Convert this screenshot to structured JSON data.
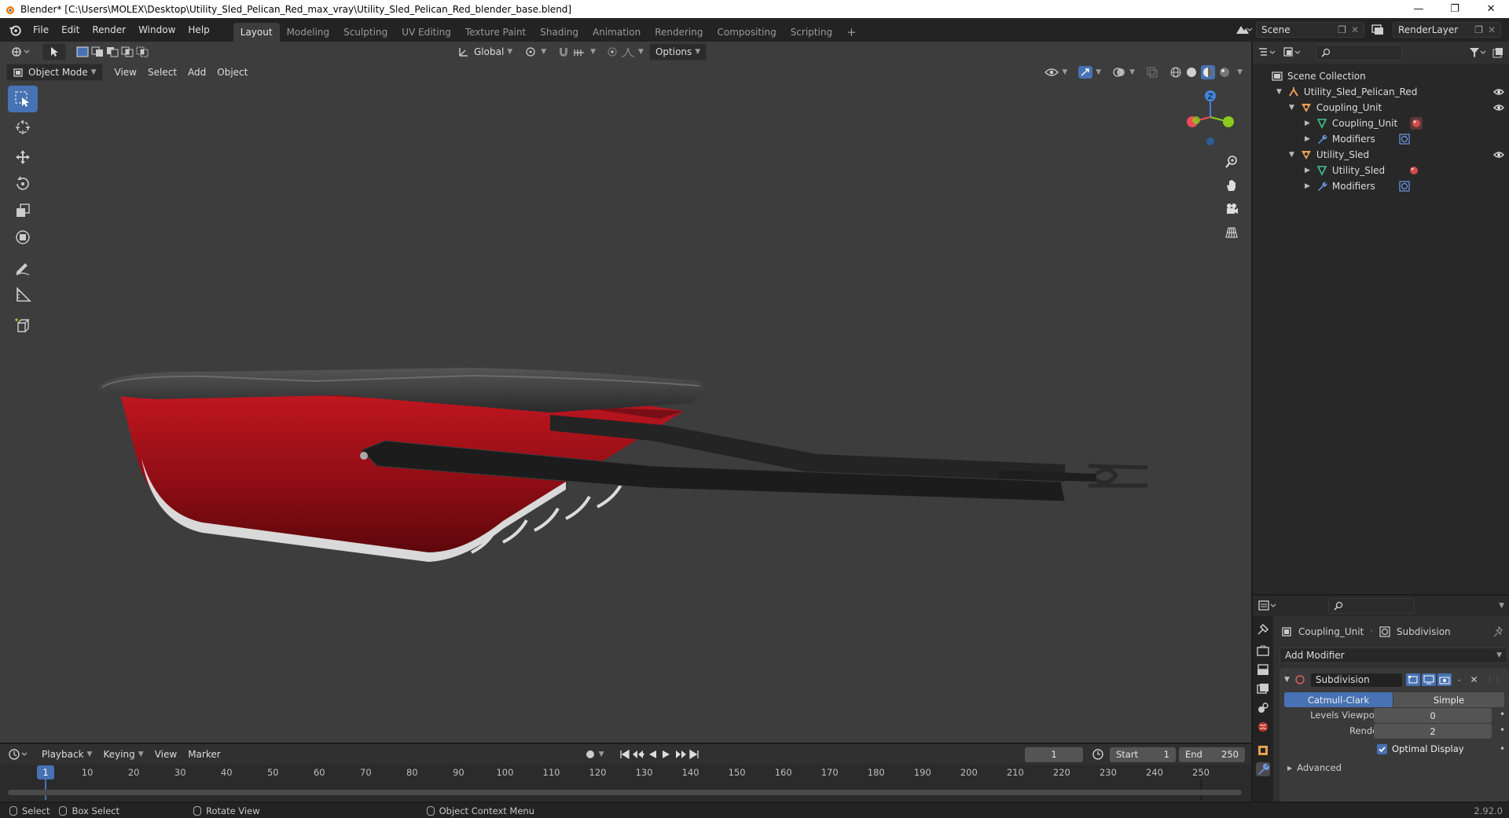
{
  "window": {
    "title": "Blender* [C:\\Users\\MOLEX\\Desktop\\Utility_Sled_Pelican_Red_max_vray\\Utility_Sled_Pelican_Red_blender_base.blend]"
  },
  "menus": [
    "File",
    "Edit",
    "Render",
    "Window",
    "Help"
  ],
  "workspaces": [
    "Layout",
    "Modeling",
    "Sculpting",
    "UV Editing",
    "Texture Paint",
    "Shading",
    "Animation",
    "Rendering",
    "Compositing",
    "Scripting"
  ],
  "active_workspace": "Layout",
  "scene": {
    "name": "Scene",
    "layer": "RenderLayer"
  },
  "viewport": {
    "transform_orientation": "Global",
    "options_label": "Options",
    "mode": "Object Mode",
    "header_menus": [
      "View",
      "Select",
      "Add",
      "Object"
    ],
    "gizmo_axes": {
      "z": "Z"
    }
  },
  "colors": {
    "accent": "#4772b3",
    "x_axis": "#ee4b58",
    "y_axis": "#8cca1f",
    "z_axis": "#3f86d9",
    "sled_red": "#b3111a"
  },
  "outliner": {
    "root": "Scene Collection",
    "rows": [
      {
        "label": "Utility_Sled_Pelican_Red",
        "icon": "armature-icon",
        "eye": true
      },
      {
        "label": "Coupling_Unit",
        "icon": "object-icon",
        "eye": true
      },
      {
        "label": "Coupling_Unit",
        "icon": "mesh-icon",
        "eye": false
      },
      {
        "label": "Modifiers",
        "icon": "wrench-icon",
        "eye": false
      },
      {
        "label": "Utility_Sled",
        "icon": "object-icon",
        "eye": true
      },
      {
        "label": "Utility_Sled",
        "icon": "mesh-icon",
        "eye": false
      },
      {
        "label": "Modifiers",
        "icon": "wrench-icon",
        "eye": false
      }
    ]
  },
  "properties": {
    "object": "Coupling_Unit",
    "modifier_ref": "Subdivision",
    "add_modifier": "Add Modifier",
    "modifier": {
      "name": "Subdivision",
      "type_a": "Catmull-Clark",
      "type_b": "Simple",
      "levels_viewport_label": "Levels Viewport",
      "levels_viewport": "0",
      "render_label": "Render",
      "render": "2",
      "optimal_display": "Optimal Display",
      "advanced": "Advanced"
    }
  },
  "timeline": {
    "menus": [
      "Playback",
      "Keying",
      "View",
      "Marker"
    ],
    "current_frame": "1",
    "start_label": "Start",
    "start": "1",
    "end_label": "End",
    "end": "250",
    "ticks": [
      "1",
      "10",
      "20",
      "30",
      "40",
      "50",
      "60",
      "70",
      "80",
      "90",
      "100",
      "110",
      "120",
      "130",
      "140",
      "150",
      "160",
      "170",
      "180",
      "190",
      "200",
      "210",
      "220",
      "230",
      "240",
      "250"
    ]
  },
  "status": {
    "select": "Select",
    "box_select": "Box Select",
    "rotate_view": "Rotate View",
    "context_menu": "Object Context Menu",
    "version": "2.92.0"
  }
}
